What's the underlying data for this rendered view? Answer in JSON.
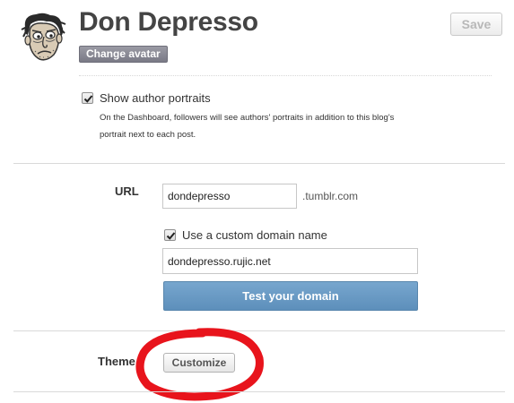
{
  "header": {
    "blog_name": "Don Depresso",
    "change_avatar_label": "Change avatar",
    "save_label": "Save"
  },
  "portraits": {
    "checked": true,
    "label": "Show author portraits",
    "help": "On the Dashboard, followers will see authors' portraits in addition to this blog's portrait next to each post."
  },
  "url": {
    "label": "URL",
    "subdomain_value": "dondepresso",
    "suffix": ".tumblr.com",
    "custom_domain_checked": true,
    "custom_domain_label": "Use a custom domain name",
    "custom_domain_value": "dondepresso.rujic.net",
    "test_button_label": "Test your domain"
  },
  "theme": {
    "label": "Theme",
    "customize_label": "Customize"
  },
  "colors": {
    "test_button": "#6699c4",
    "annotation_circle": "#e8141c",
    "save_text": "#b8b8b8"
  },
  "icons": {
    "avatar": "cartoon-face-avatar",
    "checkbox": "checkmark-icon"
  }
}
